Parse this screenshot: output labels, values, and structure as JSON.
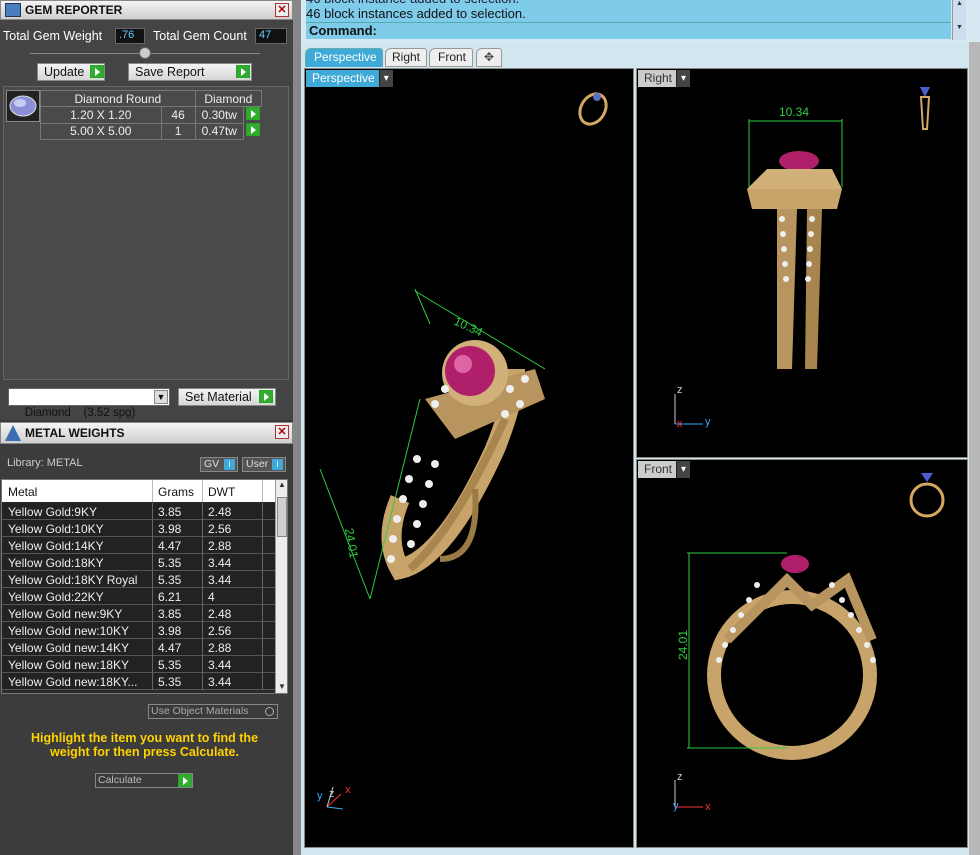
{
  "gem_reporter": {
    "title": "GEM REPORTER",
    "total_weight_label": "Total Gem Weight",
    "total_weight_value": ".76",
    "total_count_label": "Total Gem Count",
    "total_count_value": "47",
    "update_label": "Update",
    "save_report_label": "Save Report",
    "headers": [
      "Diamond Round",
      "Diamond"
    ],
    "rows": [
      {
        "size": "1.20 X 1.20",
        "count": "46",
        "weight": "0.30tw"
      },
      {
        "size": "5.00 X 5.00",
        "count": "1",
        "weight": "0.47tw"
      }
    ],
    "material_select": "Diamond    (3.52 spg)",
    "set_material_label": "Set Material"
  },
  "metal_weights": {
    "title": "METAL WEIGHTS",
    "library_label": "Library: METAL",
    "gv_label": "GV",
    "user_label": "User",
    "columns": [
      "Metal",
      "Grams",
      "DWT"
    ],
    "rows": [
      {
        "metal": "Yellow Gold:9KY",
        "grams": "3.85",
        "dwt": "2.48"
      },
      {
        "metal": "Yellow Gold:10KY",
        "grams": "3.98",
        "dwt": "2.56"
      },
      {
        "metal": "Yellow Gold:14KY",
        "grams": "4.47",
        "dwt": "2.88"
      },
      {
        "metal": "Yellow Gold:18KY",
        "grams": "5.35",
        "dwt": "3.44"
      },
      {
        "metal": "Yellow Gold:18KY Royal",
        "grams": "5.35",
        "dwt": "3.44"
      },
      {
        "metal": "Yellow Gold:22KY",
        "grams": "6.21",
        "dwt": "4"
      },
      {
        "metal": "Yellow Gold new:9KY",
        "grams": "3.85",
        "dwt": "2.48"
      },
      {
        "metal": "Yellow Gold new:10KY",
        "grams": "3.98",
        "dwt": "2.56"
      },
      {
        "metal": "Yellow Gold new:14KY",
        "grams": "4.47",
        "dwt": "2.88"
      },
      {
        "metal": "Yellow Gold new:18KY",
        "grams": "5.35",
        "dwt": "3.44"
      },
      {
        "metal": "Yellow Gold new:18KY...",
        "grams": "5.35",
        "dwt": "3.44"
      }
    ],
    "use_object_materials_label": "Use Object Materials",
    "instruction": "Highlight the item you want to find the weight for then press Calculate.",
    "calculate_label": "Calculate"
  },
  "command": {
    "history_line": "46 block instances added to selection.",
    "prompt": "Command:"
  },
  "tabs": [
    "Perspective",
    "Right",
    "Front"
  ],
  "viewports": {
    "perspective": {
      "label": "Perspective",
      "dimension_top": "10.34",
      "dimension_side": "24.01"
    },
    "right": {
      "label": "Right",
      "dimension": "10.34"
    },
    "front": {
      "label": "Front",
      "dimension": "24.01"
    }
  },
  "axes": {
    "x": "x",
    "y": "y",
    "z": "z"
  },
  "colors": {
    "accent": "#3fa9d8",
    "instruction_text": "#ffd200",
    "dimension": "#2ecc40",
    "gold": "#c9a46a",
    "gem": "#b0206a"
  }
}
